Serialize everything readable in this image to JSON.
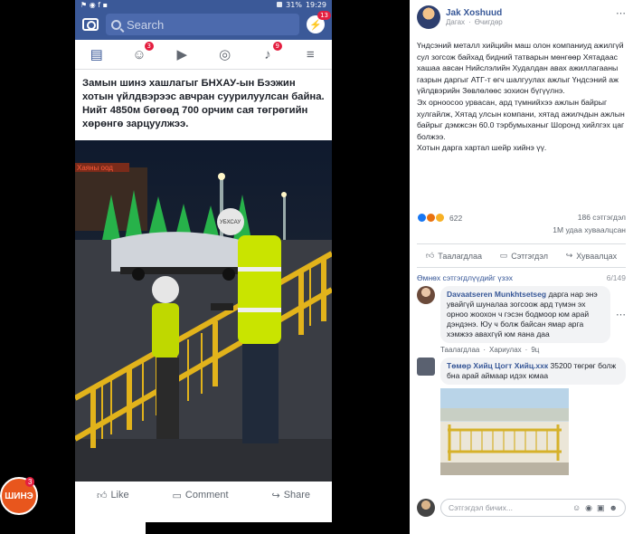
{
  "phone": {
    "status": {
      "left_icons": "⚑ ◉ f ▪",
      "battery": "31%",
      "time": "19:29"
    },
    "search_placeholder": "Search",
    "messenger_badge": "13",
    "nav_badges": {
      "friends": "3",
      "notifications": "9"
    },
    "post_text": "Замын шинэ хашлагыг БНХАУ-ын Бээжин хотын үйлдвэрээс авчран суурилуулсан байна. Нийт 4850м бөгөөд 700 орчим сая төгрөгийн хөрөнгө зарцуулжээ.",
    "photo": {
      "sign_text": "Хаяны оод",
      "helmet_text": "УБХСАУ"
    },
    "actions": {
      "like": "Like",
      "comment": "Comment",
      "share": "Share"
    },
    "logo": {
      "text": "ШИНЭ",
      "badge": "3"
    }
  },
  "panel": {
    "author": "Jak Xoshuud",
    "meta": {
      "follow": "Дагах",
      "dot": "·",
      "time": "Өчигдөр"
    },
    "body": "Үндсэний металл хийцийн маш олон компаниуд ажилгүй сул зогсож байхад бидний татварын мөнгөөр Хятадаас хашаа авсан Нийслэлийн Худалдан авах ажиллагааны газрын даргыг АТГ-т өгч шалгуулах ажлыг Үндсэний аж үйлдвэрийн Зөвлөлөөс зохион бүгүүлнэ.\nЭх орноосоо урвасан, ард түмнийхээ ажлын байрыг хулгайлж, Хятад улсын компани, хятад ажилчдын ажлын байрыг дэмжсэн 60.0 тэрбумыханыг Шоронд хийлгэх цаг болжээ.\nХотын дарга хартал шейр хийнэ үү.",
    "reaction_count": "622",
    "comments_count": "186 сэтгэгдэл",
    "shares_count": "1М удаа хуваалцсан",
    "actions": {
      "like": "Таалагдлаа",
      "comment": "Сэтгэгдэл",
      "share": "Хуваалцах"
    },
    "prev_comments": "Өмнөх сэтгэгдлүүдийг үзэх",
    "comment_counter": "6/149",
    "comments": [
      {
        "name": "Davaatseren Munkhtsetseg",
        "text": "дарга нар энэ увайгүй шуналаа зогсоож ард түмэн эх орноо жоохон ч гэсэн бодмоор юм арай дэндэнэ. Юу ч болж байсан ямар арга хэмжээ авахгүй юм яана даа",
        "meta": [
          "Таалагдлаа",
          "·",
          "Хариулах",
          "·",
          "9ц"
        ]
      },
      {
        "name": "Төмөр Хийц Цогт Хийц.ххк",
        "text": "35200 төгрөг болж бна арай аймаар идэх юмаа"
      }
    ],
    "input_placeholder": "Сэтгэгдэл бичих..."
  }
}
